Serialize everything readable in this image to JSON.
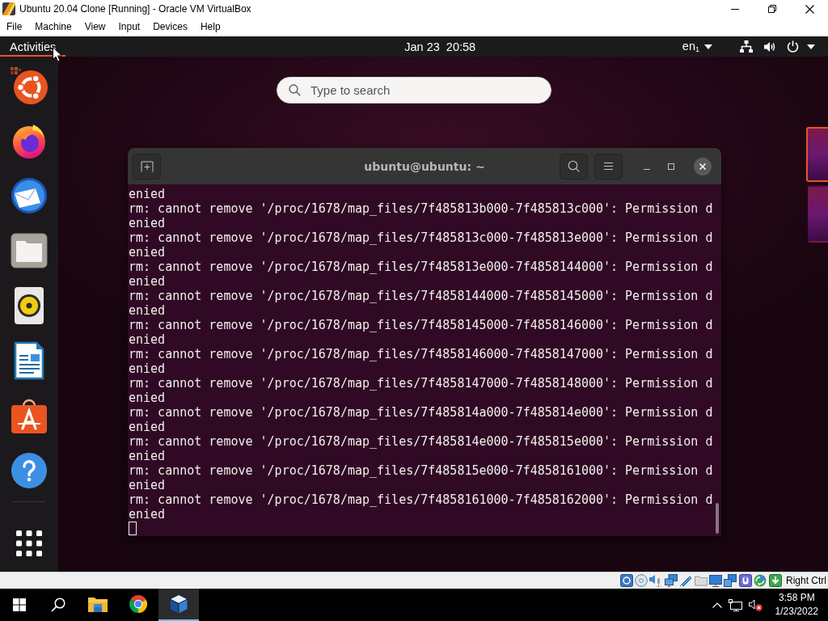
{
  "host_window": {
    "title": "Ubuntu 20.04 Clone [Running] - Oracle VM VirtualBox"
  },
  "menu_bar": [
    "File",
    "Machine",
    "View",
    "Input",
    "Devices",
    "Help"
  ],
  "top_bar": {
    "activities": {
      "label": "Activities",
      "selected": true
    },
    "clock": "Jan 23  20:58",
    "input_source": "en$_{1}$"
  },
  "search": {
    "placeholder": "Type to search"
  },
  "terminal": {
    "title": "ubuntu@ubuntu: ~",
    "lines": [
      "enied",
      "rm: cannot remove '/proc/1678/map_files/7f485813b000-7f485813c000': Permission d",
      "enied",
      "rm: cannot remove '/proc/1678/map_files/7f485813c000-7f485813e000': Permission d",
      "enied",
      "rm: cannot remove '/proc/1678/map_files/7f485813e000-7f4858144000': Permission d",
      "enied",
      "rm: cannot remove '/proc/1678/map_files/7f4858144000-7f4858145000': Permission d",
      "enied",
      "rm: cannot remove '/proc/1678/map_files/7f4858145000-7f4858146000': Permission d",
      "enied",
      "rm: cannot remove '/proc/1678/map_files/7f4858146000-7f4858147000': Permission d",
      "enied",
      "rm: cannot remove '/proc/1678/map_files/7f4858147000-7f4858148000': Permission d",
      "enied",
      "rm: cannot remove '/proc/1678/map_files/7f485814a000-7f485814e000': Permission d",
      "enied",
      "rm: cannot remove '/proc/1678/map_files/7f485814e000-7f485815e000': Permission d",
      "enied",
      "rm: cannot remove '/proc/1678/map_files/7f485815e000-7f4858161000': Permission d",
      "enied",
      "rm: cannot remove '/proc/1678/map_files/7f4858161000-7f4858162000': Permission d",
      "enied"
    ]
  },
  "workspaces": [
    {
      "selected": true
    },
    {
      "selected": false
    }
  ],
  "vm_status_bar": {
    "host_key": "Right Ctrl"
  },
  "taskbar": {
    "apps": [
      {
        "selected": false
      },
      {
        "selected": false
      },
      {
        "selected": true
      }
    ],
    "time": "3:58 PM",
    "date": "1/23/2022"
  }
}
